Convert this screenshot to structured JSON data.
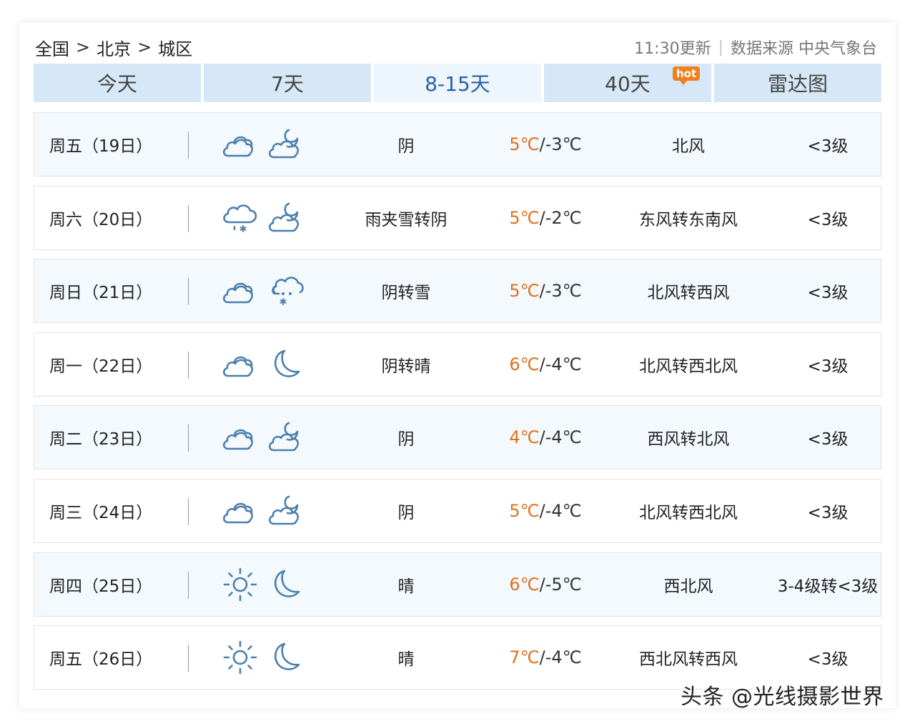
{
  "breadcrumb": {
    "items": [
      "全国",
      "北京",
      "城区"
    ],
    "separator": ">"
  },
  "meta": {
    "update_time": "11:30更新",
    "separator": "|",
    "source_label": "数据来源 中央气象台"
  },
  "tabs": [
    {
      "label": "今天",
      "active": false
    },
    {
      "label": "7天",
      "active": false
    },
    {
      "label": "8-15天",
      "active": true
    },
    {
      "label": "40天",
      "active": false,
      "badge": "hot"
    },
    {
      "label": "雷达图",
      "active": false
    }
  ],
  "forecast": [
    {
      "date": "周五（19日）",
      "day_icon": "cloudy-icon",
      "night_icon": "partly-cloudy-night-icon",
      "desc": "阴",
      "high": "5℃",
      "low": "-3℃",
      "wind": "北风",
      "level": "<3级"
    },
    {
      "date": "周六（20日）",
      "day_icon": "sleet-icon",
      "night_icon": "partly-cloudy-night-icon",
      "desc": "雨夹雪转阴",
      "high": "5℃",
      "low": "-2℃",
      "wind": "东风转东南风",
      "level": "<3级"
    },
    {
      "date": "周日（21日）",
      "day_icon": "cloudy-icon",
      "night_icon": "snow-icon",
      "desc": "阴转雪",
      "high": "5℃",
      "low": "-3℃",
      "wind": "北风转西风",
      "level": "<3级"
    },
    {
      "date": "周一（22日）",
      "day_icon": "cloudy-icon",
      "night_icon": "moon-icon",
      "desc": "阴转晴",
      "high": "6℃",
      "low": "-4℃",
      "wind": "北风转西北风",
      "level": "<3级"
    },
    {
      "date": "周二（23日）",
      "day_icon": "cloudy-icon",
      "night_icon": "partly-cloudy-night-icon",
      "desc": "阴",
      "high": "4℃",
      "low": "-4℃",
      "wind": "西风转北风",
      "level": "<3级"
    },
    {
      "date": "周三（24日）",
      "day_icon": "cloudy-icon",
      "night_icon": "partly-cloudy-night-icon",
      "desc": "阴",
      "high": "5℃",
      "low": "-4℃",
      "wind": "北风转西北风",
      "level": "<3级"
    },
    {
      "date": "周四（25日）",
      "day_icon": "sun-icon",
      "night_icon": "moon-icon",
      "desc": "晴",
      "high": "6℃",
      "low": "-5℃",
      "wind": "西北风",
      "level": "3-4级转<3级"
    },
    {
      "date": "周五（26日）",
      "day_icon": "sun-icon",
      "night_icon": "moon-icon",
      "desc": "晴",
      "high": "7℃",
      "low": "-4℃",
      "wind": "西北风转西风",
      "level": "<3级"
    }
  ],
  "temp_separator": "/",
  "watermark": "头条 @光线摄影世界",
  "colors": {
    "tab_bg": "#d6e8f7",
    "tab_active_bg": "#eef6fd",
    "tab_active_text": "#2a5fa6",
    "high_temp": "#e1701e",
    "hot_badge": "#f0801e",
    "icon_stroke": "#4a7fae"
  }
}
